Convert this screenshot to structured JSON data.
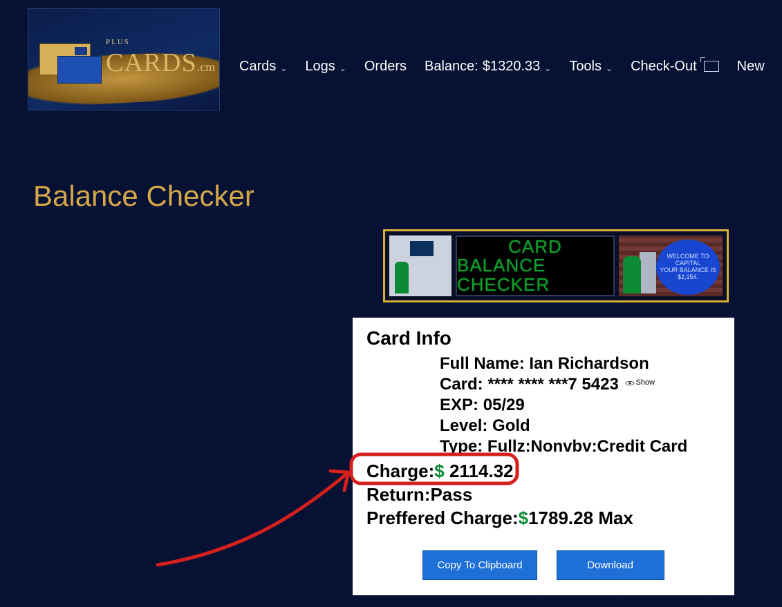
{
  "logo": {
    "plus": "PLUS",
    "brand": "CARDS",
    "tld": ".cm"
  },
  "nav": {
    "cards": "Cards",
    "logs": "Logs",
    "orders": "Orders",
    "balance_label": "Balance:",
    "balance_value": "$1320.33",
    "tools": "Tools",
    "checkout": "Check-Out",
    "new": "New"
  },
  "page_title": "Balance Checker",
  "banner": {
    "line1": "CARD",
    "line2": "BALANCE CHECKER",
    "bubble_line1": "WELCOME TO CAPITAL",
    "bubble_line2": "YOUR BALANCE IS",
    "bubble_line3": "$2,154."
  },
  "card": {
    "heading": "Card Info",
    "fullname_label": "Full Name:",
    "fullname_value": "Ian Richardson",
    "card_label": "Card:",
    "card_value": "**** **** ***7 5423",
    "show_label": "Show",
    "exp_label": "EXP:",
    "exp_value": "05/29",
    "level_label": "Level:",
    "level_value": "Gold",
    "type_label": "Type:",
    "type_value": "Fullz:Nonvbv:Credit Card",
    "charge_label": "Charge:",
    "charge_value": "2114.32",
    "return_label": "Return:",
    "return_value": "Pass",
    "pref_label": "Preffered Charge:",
    "pref_value": "1789.28",
    "pref_suffix": "Max"
  },
  "buttons": {
    "copy": "Copy To Clipboard",
    "download": "Download"
  }
}
